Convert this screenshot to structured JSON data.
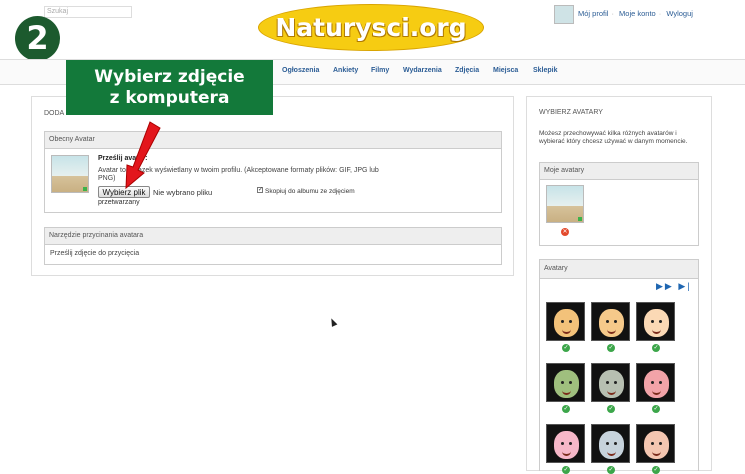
{
  "header": {
    "search_placeholder": "Szukaj",
    "logo_text": "Naturysci.org",
    "step_number": "2",
    "user_links": [
      "Mój profil",
      "Moje konto",
      "Wyloguj"
    ]
  },
  "nav": {
    "items": [
      "Ogłoszenia",
      "Ankiety",
      "Filmy",
      "Wydarzenia",
      "Zdjęcia",
      "Miejsca",
      "Sklepik"
    ]
  },
  "banner": {
    "line1": "Wybierz zdjęcie",
    "line2": "z komputera"
  },
  "main": {
    "title": "DODA",
    "current_avatar": {
      "header": "Obecny Avatar",
      "upload_title": "Prześlij  avatar:",
      "upload_desc": "Avatar to obrazek wyświetlany w twoim profilu. (Akceptowane formaty plików: GIF, JPG lub PNG)",
      "file_button": "Wybierz plik",
      "file_status": "Nie wybrano pliku",
      "file_status2": "przetwarzany",
      "checkbox_label": "Skopiuj do albumu ze zdjęciem"
    },
    "crop_tool": {
      "header": "Narzędzie przycinania avatara",
      "text": "Prześlij zdjęcie do przycięcia"
    }
  },
  "sidebar": {
    "title": "WYBIERZ AVATARY",
    "description": "Możesz przechowywać kilka różnych avatarów i wybierać który chcesz używać w danym momencie.",
    "my_avatars_header": "Moje avatary",
    "avatars_header": "Avatary",
    "avatar_icons": [
      {
        "name": "avatar-smiling-man",
        "color": "#f3c27a"
      },
      {
        "name": "avatar-glasses-man",
        "color": "#f5c98a"
      },
      {
        "name": "avatar-blonde-woman",
        "color": "#fbd9b5"
      },
      {
        "name": "avatar-sunglasses-man",
        "color": "#9fbf7e"
      },
      {
        "name": "avatar-grey-hair-man",
        "color": "#b7bfb1"
      },
      {
        "name": "avatar-pig-face",
        "color": "#f2a3a8"
      },
      {
        "name": "avatar-pink-face",
        "color": "#f6b7c8"
      },
      {
        "name": "avatar-grey-face",
        "color": "#c7d3dc"
      },
      {
        "name": "avatar-peach-face",
        "color": "#f4c6b1"
      }
    ]
  },
  "colors": {
    "accent_green": "#13793a",
    "step_circle": "#1c5a2e",
    "logo_yellow": "#f6cc12",
    "link_blue": "#2c5d95"
  }
}
